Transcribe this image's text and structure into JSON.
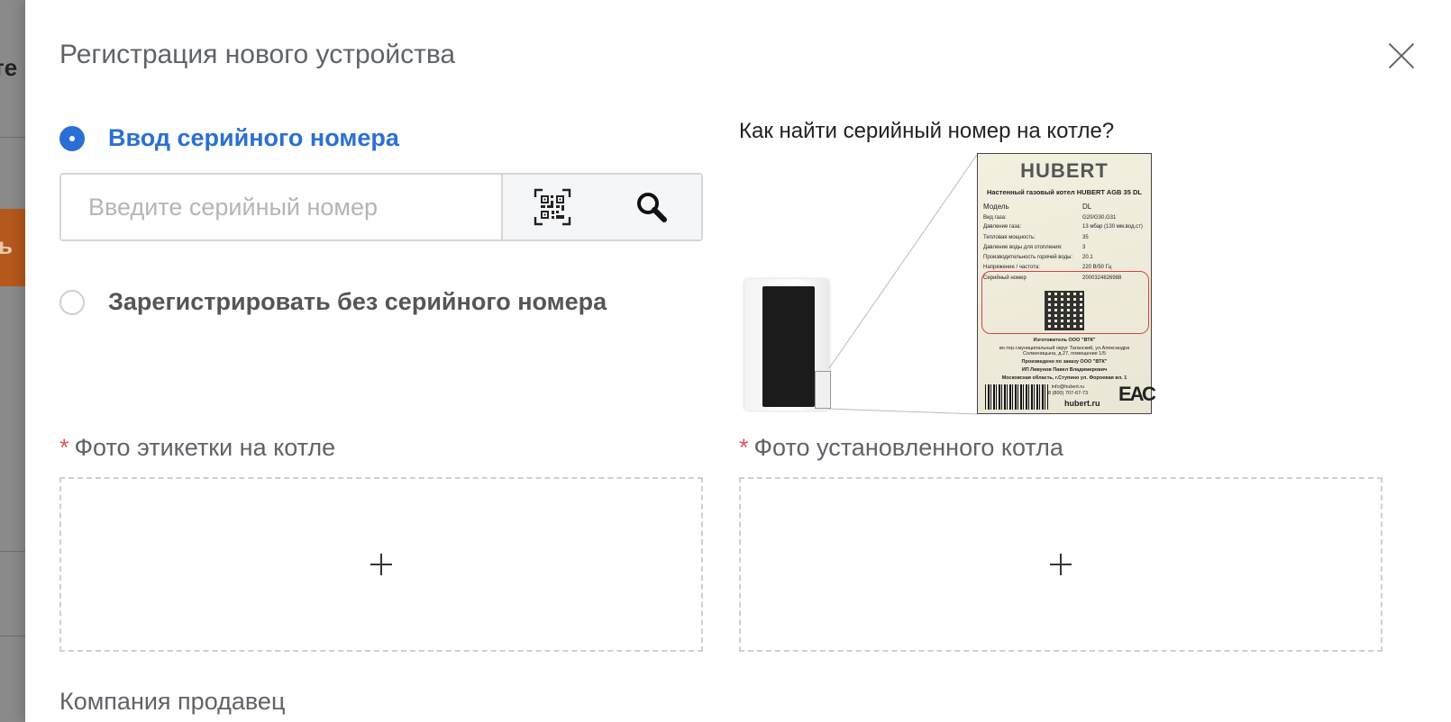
{
  "background": {
    "partial_text": "те",
    "orange_text": "ь"
  },
  "modal": {
    "title": "Регистрация нового устройства",
    "close_icon": "close-icon"
  },
  "options": {
    "serial": {
      "label": "Ввод серийного номера",
      "selected": true,
      "placeholder": "Введите серийный номер",
      "qr_icon": "qr-code-icon",
      "search_icon": "search-icon"
    },
    "no_serial": {
      "label": "Зарегистрировать без серийного номера",
      "selected": false
    }
  },
  "help": {
    "question": "Как найти серийный номер на котле?",
    "plate": {
      "brand": "HUBERT",
      "model_title": "Настенный газовый котел HUBERT AGB 35 DL",
      "rows": [
        {
          "k": "Модель",
          "v": "DL"
        },
        {
          "k": "Вид газа:",
          "v": "G20/G30,G31"
        },
        {
          "k": "Давление газа:",
          "v": "13 мбар (130 мм.вод.ст)"
        },
        {
          "k": "Тепловая мощность:",
          "v": "35"
        },
        {
          "k": "Давление воды для отопления:",
          "v": "3"
        },
        {
          "k": "Производительность горячей воды:",
          "v": "20.1"
        },
        {
          "k": "Напряжение / частота:",
          "v": "220 В/50 Гц"
        },
        {
          "k": "Серийный номер",
          "v": "2000324826988"
        }
      ],
      "maker": "Изготовитель ООО \"ВТК\"",
      "address": "вн.тер.г.муниципальный округ Таганский, ул.Александра Солженицына, д.27, помещение 1/5",
      "ordered": "Произведено по заказу ООО \"ВТК\"",
      "person": "ИП Ливунов Павел Владимирович",
      "region": "Московская область, г.Ступино ул. Фороевая вл. 1",
      "email": "info@hubert.ru",
      "phone": "8 (800) 707-67-73",
      "site": "hubert.ru",
      "mark": "ЕАС"
    }
  },
  "uploads": {
    "label_photo": {
      "required_mark": "*",
      "label": "Фото этикетки на котле",
      "icon": "plus-icon"
    },
    "installed_photo": {
      "required_mark": "*",
      "label": "Фото установленного котла",
      "icon": "plus-icon"
    }
  },
  "company": {
    "label": "Компания продавец"
  }
}
